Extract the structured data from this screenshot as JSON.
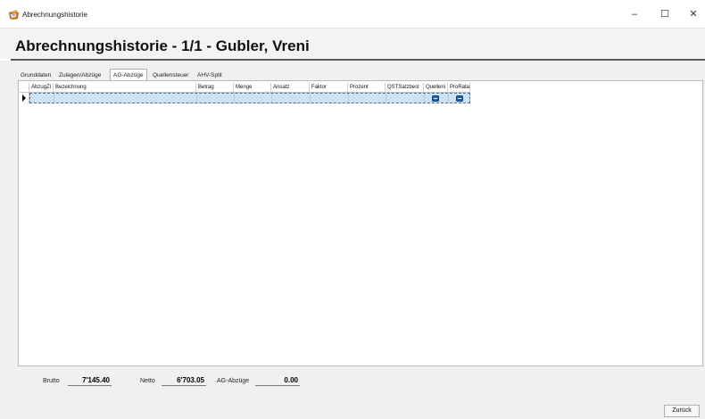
{
  "window": {
    "title": "Abrechnungshistorie",
    "controls": {
      "minimize": "–",
      "maximize": "☐",
      "close": "✕"
    }
  },
  "header": {
    "title": "Abrechnungshistorie - 1/1 - Gubler, Vreni"
  },
  "tabs": [
    {
      "label": "Grunddaten"
    },
    {
      "label": "Zulagen/Abzüge"
    },
    {
      "label": "AG-Abzüge"
    },
    {
      "label": "Quellensteuer"
    },
    {
      "label": "AHV-Split"
    }
  ],
  "active_tab": "AG-Abzüge",
  "grid": {
    "columns": [
      "AbzugZi",
      "Bezeichnung",
      "Betrag",
      "Menge",
      "Ansatz",
      "Faktor",
      "Prozent",
      "QSTSatzbest",
      "Quelleni",
      "ProRata"
    ],
    "rows": [
      {
        "AbzugZi": "",
        "Bezeichnung": "",
        "Betrag": "",
        "Menge": "",
        "Ansatz": "",
        "Faktor": "",
        "Prozent": "",
        "QSTSatzbest": "",
        "Quelleni": true,
        "ProRata": true
      }
    ]
  },
  "footer": {
    "brutto_label": "Brutto",
    "brutto_value": "7'145.40",
    "netto_label": "Netto",
    "netto_value": "6'703.05",
    "ag_label": "AG-Abzüge",
    "ag_value": "0.00"
  },
  "buttons": {
    "back": "Zurück"
  },
  "colors": {
    "selected_row": "#cce3f7",
    "checkbox": "#1f5fb8",
    "header_band": "#f3f3f3"
  }
}
